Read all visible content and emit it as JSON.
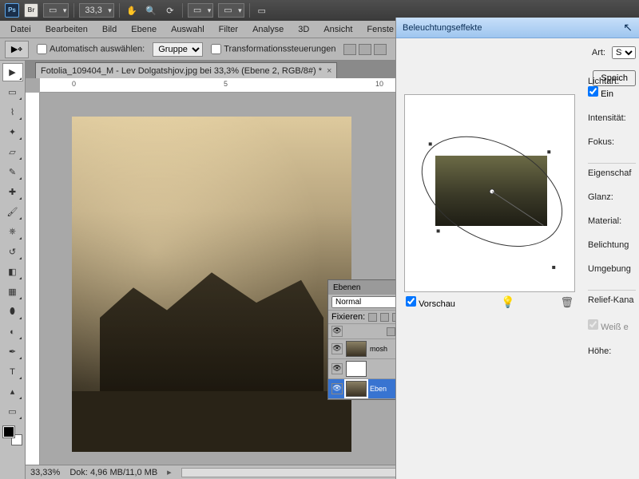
{
  "appbar": {
    "ps": "Ps",
    "br": "Br",
    "zoom_dd": "33,3"
  },
  "menu": {
    "items": [
      "Datei",
      "Bearbeiten",
      "Bild",
      "Ebene",
      "Auswahl",
      "Filter",
      "Analyse",
      "3D",
      "Ansicht",
      "Fenste"
    ]
  },
  "optbar": {
    "auto_select": "Automatisch auswählen:",
    "group": "Gruppe",
    "transform": "Transformationssteuerungen"
  },
  "doc": {
    "tab_title": "Fotolia_109404_M - Lev Dolgatshjov.jpg bei 33,3% (Ebene 2, RGB/8#) *",
    "ruler_marks": [
      "0",
      "5",
      "10"
    ],
    "zoom_status": "33,33%",
    "doc_size_label": "Dok:",
    "doc_size": "4,96 MB/11,0 MB"
  },
  "layers": {
    "title": "Ebenen",
    "blend": "Normal",
    "lock_label": "Fixieren:",
    "items": [
      {
        "name": "mosh"
      },
      {
        "name": ""
      },
      {
        "name": "Eben"
      }
    ]
  },
  "dialog": {
    "title": "Beleuchtungseffekte",
    "art_label": "Art:",
    "art_value": "Sta",
    "save": "Speich",
    "lichtart": "Lichtart:",
    "ein": "Ein",
    "intensitat": "Intensität:",
    "fokus": "Fokus:",
    "eigenschaften": "Eigenschaf",
    "glanz": "Glanz:",
    "material": "Material:",
    "belichtung": "Belichtung",
    "umgebung": "Umgebung",
    "relief": "Relief-Kana",
    "weiss": "Weiß e",
    "hoehe": "Höhe:",
    "vorschau": "Vorschau"
  }
}
